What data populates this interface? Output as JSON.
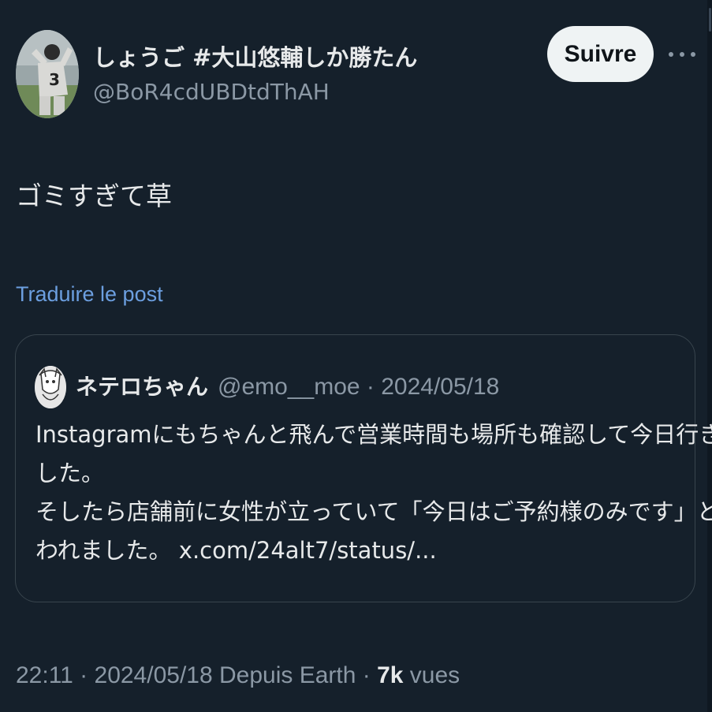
{
  "author": {
    "display_name": "しょうご #大山悠輔しか勝たん",
    "handle": "@BoR4cdUBDtdThAH",
    "avatar_icon": "baseball-player-photo"
  },
  "follow_button": {
    "label": "Suivre"
  },
  "more_menu_icon": "more-horizontal-icon",
  "tweet": {
    "text": "ゴミすぎて草"
  },
  "translate": {
    "label": "Traduire le post"
  },
  "quote": {
    "display_name": "ネテロちゃん",
    "handle_date": "@emo__moe · 2024/05/18",
    "avatar_icon": "drawing-avatar",
    "lines": [
      "Instagramにもちゃんと飛んで営業時間も場所も確認して今日行きま",
      "した。",
      "そしたら店舗前に女性が立っていて「今日はご予約様のみです」と言",
      "われました。"
    ],
    "link": "x.com/24alt7/status/..."
  },
  "meta": {
    "time_date_source": "22:11 · 2024/05/18 Depuis Earth · ",
    "views_count": "7k",
    "views_label": " vues"
  },
  "colors": {
    "background": "#15202b",
    "text": "#e7e9ea",
    "secondary": "#8b98a5",
    "link": "#6c9fe0",
    "border": "#38444d",
    "button_bg": "#eff3f4"
  }
}
